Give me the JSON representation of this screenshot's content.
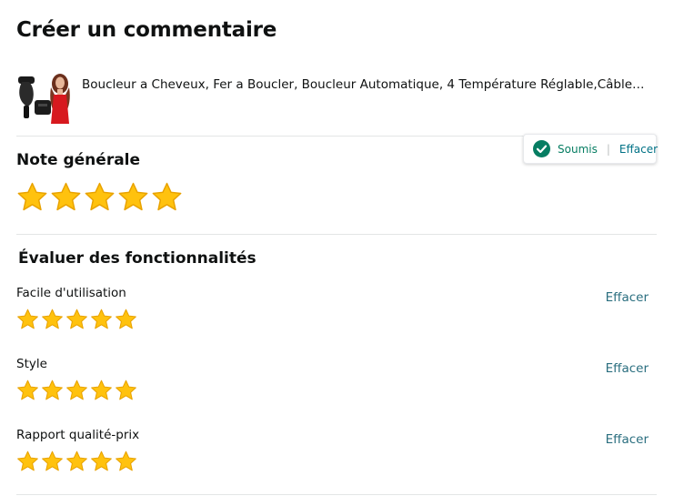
{
  "page": {
    "title": "Créer un commentaire"
  },
  "product": {
    "title": "Boucleur a Cheveux, Fer a Boucler, Boucleur Automatique, 4 Température Réglable,Câble Anti-e...",
    "thumbnail_icon": "product-image"
  },
  "overall": {
    "heading": "Note générale",
    "rating": 5,
    "max": 5,
    "status": {
      "label": "Soumis",
      "separator": "|",
      "clear_label": "Effacer",
      "color": "#067d62"
    }
  },
  "features": {
    "heading": "Évaluer des fonctionnalités",
    "items": [
      {
        "label": "Facile d'utilisation",
        "rating": 5,
        "max": 5,
        "clear_label": "Effacer"
      },
      {
        "label": "Style",
        "rating": 5,
        "max": 5,
        "clear_label": "Effacer"
      },
      {
        "label": "Rapport qualité-prix",
        "rating": 5,
        "max": 5,
        "clear_label": "Effacer"
      }
    ]
  },
  "colors": {
    "star_fill": "#ffc20e",
    "star_stroke": "#e8a200",
    "link": "#007185",
    "divider": "#e3e6e6"
  }
}
